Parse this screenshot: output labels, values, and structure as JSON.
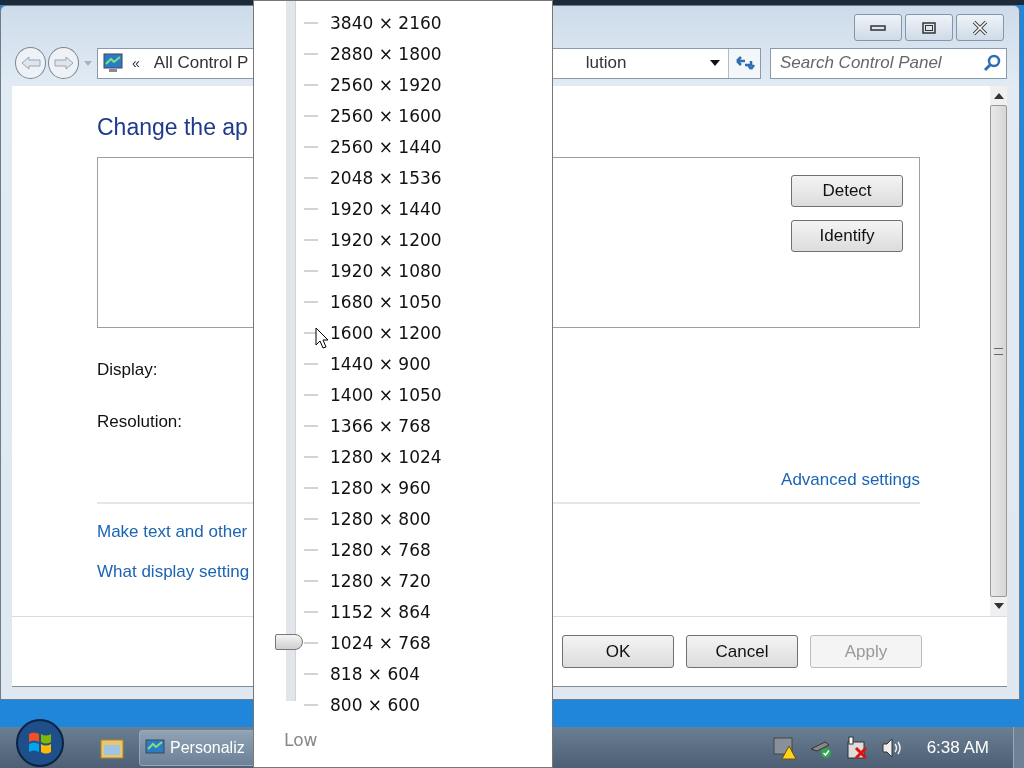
{
  "window": {
    "address_chevron": "«",
    "address_start": "All Control P",
    "address_end": "lution",
    "search": {
      "placeholder": "Search Control Panel"
    },
    "heading": "Change the ap",
    "monitor_buttons": [
      "Detect",
      "Identify"
    ],
    "display_label": "Display:",
    "resolution_label": "Resolution:",
    "advanced_link": "Advanced settings",
    "links": [
      "Make text and other",
      "What display setting"
    ],
    "footer_buttons": [
      {
        "label": "OK",
        "disabled": false
      },
      {
        "label": "Cancel",
        "disabled": false
      },
      {
        "label": "Apply",
        "disabled": true
      }
    ]
  },
  "resolution_popup": {
    "options": [
      "3840 × 2160",
      "2880 × 1800",
      "2560 × 1920",
      "2560 × 1600",
      "2560 × 1440",
      "2048 × 1536",
      "1920 × 1440",
      "1920 × 1200",
      "1920 × 1080",
      "1680 × 1050",
      "1600 × 1200",
      "1440 × 900",
      "1400 × 1050",
      "1366 × 768",
      "1280 × 1024",
      "1280 × 960",
      "1280 × 800",
      "1280 × 768",
      "1280 × 720",
      "1152 × 864",
      "1024 × 768",
      "818 × 604",
      "800 × 600"
    ],
    "slider": {
      "level": 0.0909
    },
    "low_label": "Low"
  },
  "taskbar": {
    "task": "Personaliz",
    "clock": "6:38 AM"
  }
}
